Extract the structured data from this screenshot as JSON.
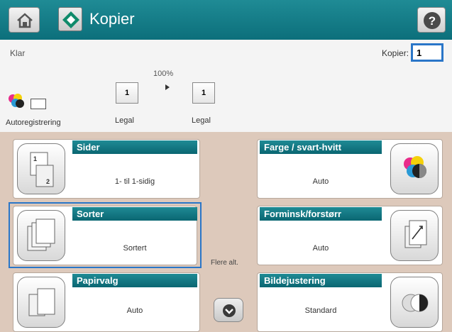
{
  "header": {
    "title": "Kopier",
    "home_icon": "home-icon",
    "app_icon": "copy-app-icon",
    "help_icon": "help-icon",
    "bar_color": "#0f7a86"
  },
  "status": {
    "state": "Klar",
    "copies_label": "Kopier:",
    "copies_value": "1",
    "zoom": "100%",
    "source": {
      "count": "1",
      "paper": "Legal"
    },
    "output": {
      "count": "1",
      "paper": "Legal"
    },
    "color_mode_label": "Autoregistrering"
  },
  "tiles": {
    "sider": {
      "title": "Sider",
      "value": "1- til 1-sidig"
    },
    "farge": {
      "title": "Farge / svart-hvitt",
      "value": "Auto"
    },
    "sorter": {
      "title": "Sorter",
      "value": "Sortert"
    },
    "forminsk": {
      "title": "Forminsk/forstørr",
      "value": "Auto"
    },
    "papirvalg": {
      "title": "Papirvalg",
      "value": "Auto"
    },
    "bildejustering": {
      "title": "Bildejustering",
      "value": "Standard"
    }
  },
  "more_options": "Flere alt.",
  "accent_color": "#2a76c8",
  "panel_color": "#ddc9bb"
}
